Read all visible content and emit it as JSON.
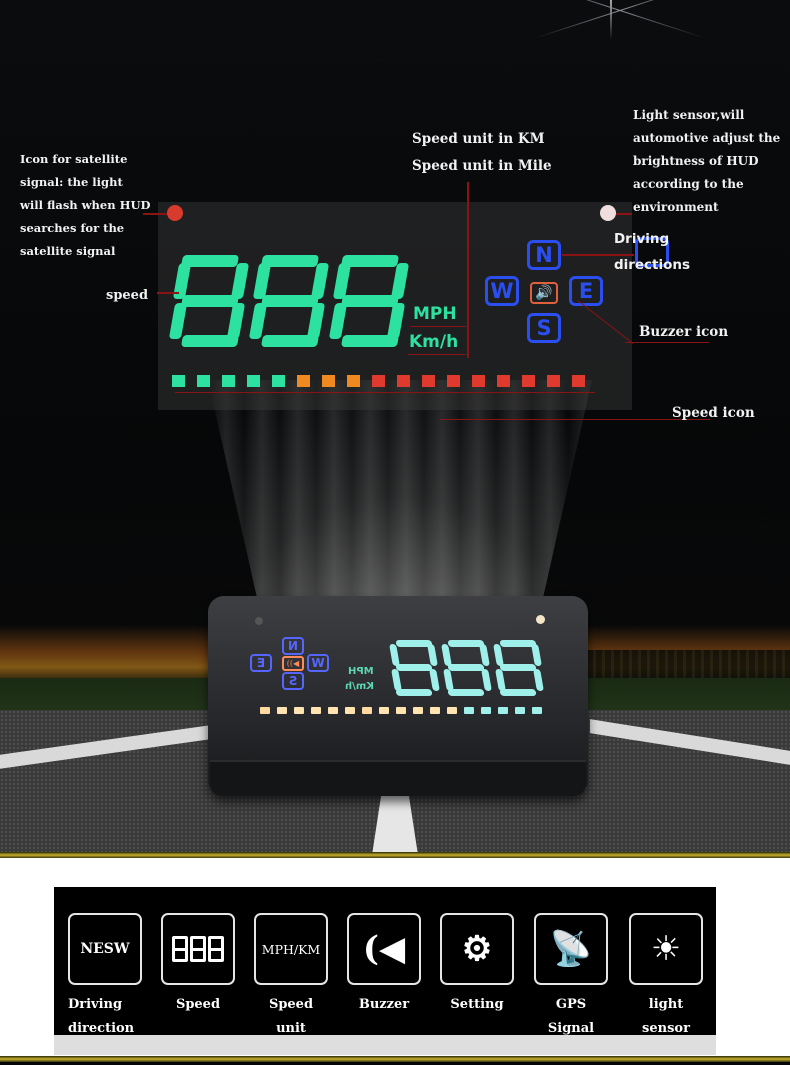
{
  "annotations": {
    "satellite": "Icon for satellite\nsignal: the light\nwill flash when HUD\nsearches for the\nsatellite signal",
    "speed": "speed",
    "unit_km": "Speed unit in KM",
    "unit_mile": "Speed unit in Mile",
    "light_sensor": "Light sensor,will\nautomotive adjust the\nbrightness of HUD\naccording to the\nenvironment",
    "driving_directions": "Driving\ndirections",
    "buzzer_icon": "Buzzer icon",
    "speed_icon": "Speed icon"
  },
  "hud": {
    "digits": [
      "8",
      "8",
      "8"
    ],
    "unit_mph": "MPH",
    "unit_kmh": "Km/h",
    "directions": {
      "n": "N",
      "w": "W",
      "e": "E",
      "s": "S"
    },
    "buzzer_glyph": "🔊",
    "led_bar": [
      "#2de2a0",
      "#2de2a0",
      "#2de2a0",
      "#2de2a0",
      "#2de2a0",
      "#f08a20",
      "#f08a20",
      "#f08a20",
      "#e03a2e",
      "#e03a2e",
      "#e03a2e",
      "#e03a2e",
      "#e03a2e",
      "#e03a2e",
      "#e03a2e",
      "#e03a2e",
      "#e03a2e"
    ],
    "colors": {
      "digits": "#2de2a0",
      "directions": "#2a4ef0",
      "buzzer": "#e0603c",
      "satellite_dot": "#d93a2e",
      "light_dot": "#f0dede"
    }
  },
  "device": {
    "digits": [
      "8",
      "8",
      "8"
    ],
    "unit_mph": "MPH",
    "unit_kmh": "Km/h",
    "directions": {
      "n": "N",
      "e": "E",
      "w": "W",
      "s": "S"
    },
    "buzzer_glyph": "((◀",
    "led_bar": [
      "#ffd9a0",
      "#ffe3b0",
      "#ffe3b0",
      "#ffe3b0",
      "#ffe3b0",
      "#ffe3b0",
      "#ffd9a0",
      "#ffe3b0",
      "#ffe3b0",
      "#ffe3b0",
      "#ffe3b0",
      "#ffe3b0",
      "#9ff0ea",
      "#9ff0ea",
      "#9ff0ea",
      "#9ff0ea",
      "#9ff0ea"
    ]
  },
  "features": [
    {
      "icon": "nesw-text-icon",
      "box_text": "NESW",
      "label": "Driving\ndirection"
    },
    {
      "icon": "seven-segment-icon",
      "box_text": "",
      "label": "Speed"
    },
    {
      "icon": "unit-text-icon",
      "box_text": "MPH/KM",
      "label": "Speed unit"
    },
    {
      "icon": "speaker-icon",
      "box_text": "(◀",
      "label": "Buzzer"
    },
    {
      "icon": "gear-icon",
      "box_text": "⚙",
      "label": "Setting"
    },
    {
      "icon": "satellite-dish-icon",
      "box_text": "📡",
      "label": "GPS Signal"
    },
    {
      "icon": "sun-icon",
      "box_text": "☀",
      "label": "light sensor"
    }
  ]
}
